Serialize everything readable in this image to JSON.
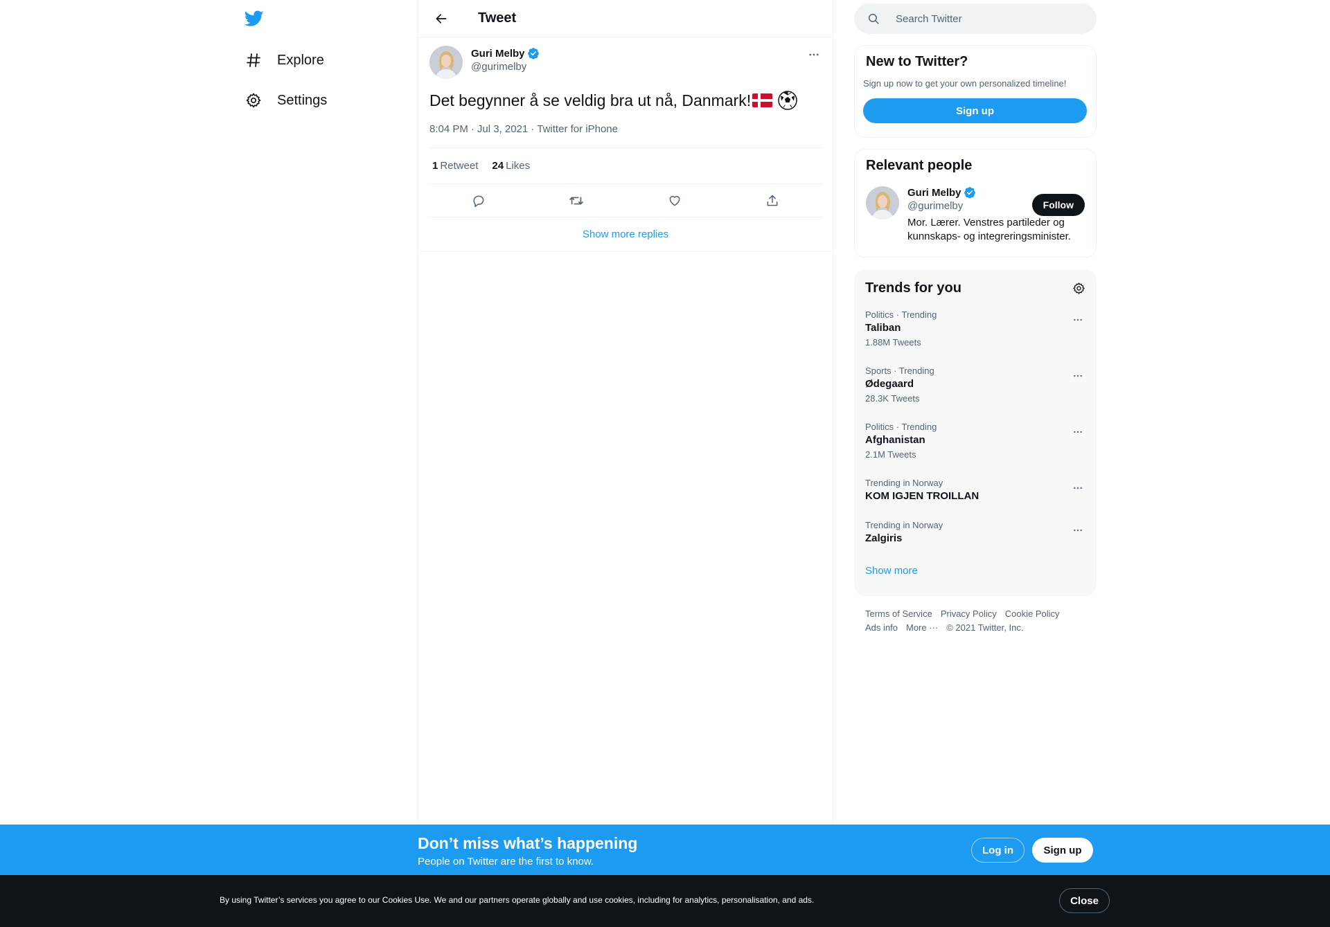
{
  "nav": {
    "items": [
      {
        "label": "Explore",
        "icon": "hashtag-icon"
      },
      {
        "label": "Settings",
        "icon": "gear-icon"
      }
    ]
  },
  "colors": {
    "brand": "#1d9bf0",
    "text": "#0f1419",
    "secondary": "#536471",
    "border": "#eff3f4"
  },
  "header": {
    "title": "Tweet"
  },
  "tweet": {
    "author_name": "Guri Melby",
    "author_handle": "@gurimelby",
    "text": "Det begynner å se veldig bra ut nå, Danmark!",
    "time": "8:04 PM",
    "date": "Jul 3, 2021",
    "separator": "·",
    "source": "Twitter for iPhone",
    "retweet_count": "1",
    "retweet_label": "Retweet",
    "like_count": "24",
    "like_label": "Likes",
    "show_more_replies": "Show more replies"
  },
  "search": {
    "placeholder": "Search Twitter"
  },
  "new_to_twitter": {
    "title": "New to Twitter?",
    "subtitle": "Sign up now to get your own personalized timeline!",
    "signup_label": "Sign up"
  },
  "relevant_people": {
    "title": "Relevant people",
    "name": "Guri Melby",
    "handle": "@gurimelby",
    "bio": "Mor. Lærer. Venstres partileder og kunnskaps- og integreringsminister.",
    "follow_label": "Follow"
  },
  "trends": {
    "title": "Trends for you",
    "items": [
      {
        "context": "Politics · Trending",
        "name": "Taliban",
        "count": "1.88M Tweets"
      },
      {
        "context": "Sports · Trending",
        "name": "Ødegaard",
        "count": "28.3K Tweets"
      },
      {
        "context": "Politics · Trending",
        "name": "Afghanistan",
        "count": "2.1M Tweets"
      },
      {
        "context": "Trending in Norway",
        "name": "KOM IGJEN TROILLAN",
        "count": ""
      },
      {
        "context": "Trending in Norway",
        "name": "Zalgiris",
        "count": ""
      }
    ],
    "show_more": "Show more"
  },
  "footer": {
    "terms": "Terms of Service",
    "privacy": "Privacy Policy",
    "cookie": "Cookie Policy",
    "ads": "Ads info",
    "more": "More ···",
    "copyright": "© 2021 Twitter, Inc."
  },
  "login_bar": {
    "title": "Don’t miss what’s happening",
    "subtitle": "People on Twitter are the first to know.",
    "login_label": "Log in",
    "signup_label": "Sign up"
  },
  "cookie_bar": {
    "text": "By using Twitter’s services you agree to our Cookies Use. We and our partners operate globally and use cookies, including for analytics, personalisation, and ads.",
    "close_label": "Close"
  }
}
